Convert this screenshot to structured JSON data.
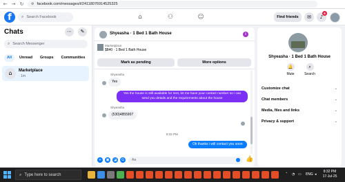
{
  "browser": {
    "url": "facebook.com/messages/t/24118076914525325",
    "back_icon": "arrow-left-icon",
    "forward_icon": "arrow-right-icon",
    "reload_icon": "reload-icon"
  },
  "fb_bar": {
    "logo": "f",
    "search_placeholder": "Search Facebook",
    "find_friends_label": "Find friends",
    "notification_count": "6"
  },
  "chats": {
    "title": "Chats",
    "search_placeholder": "Search Messenger",
    "filters": [
      "All",
      "Unread",
      "Groups",
      "Communities"
    ],
    "items": [
      {
        "name": "Marketplace",
        "sub": "· 1m"
      }
    ]
  },
  "conversation": {
    "title": "Shyeasha · 1 Bed 1 Bath House",
    "info_glyph": "i",
    "listing": {
      "market_label": "Marketplace",
      "listing_title": "$840 · 1 Bed 1 Bath House",
      "pending_label": "Mark as pending",
      "more_label": "More options"
    },
    "messages": [
      {
        "sender": "Shyeasha",
        "text": "Yes"
      },
      {
        "text": "Yes the house is still available for rent, let me have your contact number so i can send you details and the requirements about the house"
      },
      {
        "sender": "Shyeasha",
        "text": "(530)4855907"
      },
      {
        "text": "Ok thanks i will contact you soon"
      }
    ],
    "timestamp": "8:32 PM",
    "composer_placeholder": "Aa"
  },
  "info_panel": {
    "name": "Shyeasha · 1 Bed 1 Bath House",
    "actions": [
      "Mute",
      "Search"
    ],
    "rows": [
      "Customize chat",
      "Chat members",
      "Media, files and links",
      "Privacy & support"
    ]
  },
  "taskbar": {
    "search_placeholder": "Type here to search",
    "language": "ENG",
    "time": "8:32 PM",
    "date": "17-Jul-25"
  },
  "colors": {
    "fb_blue": "#1877f2",
    "messenger_purple": "#7b2ff7",
    "messenger_blue": "#0a7cff"
  }
}
